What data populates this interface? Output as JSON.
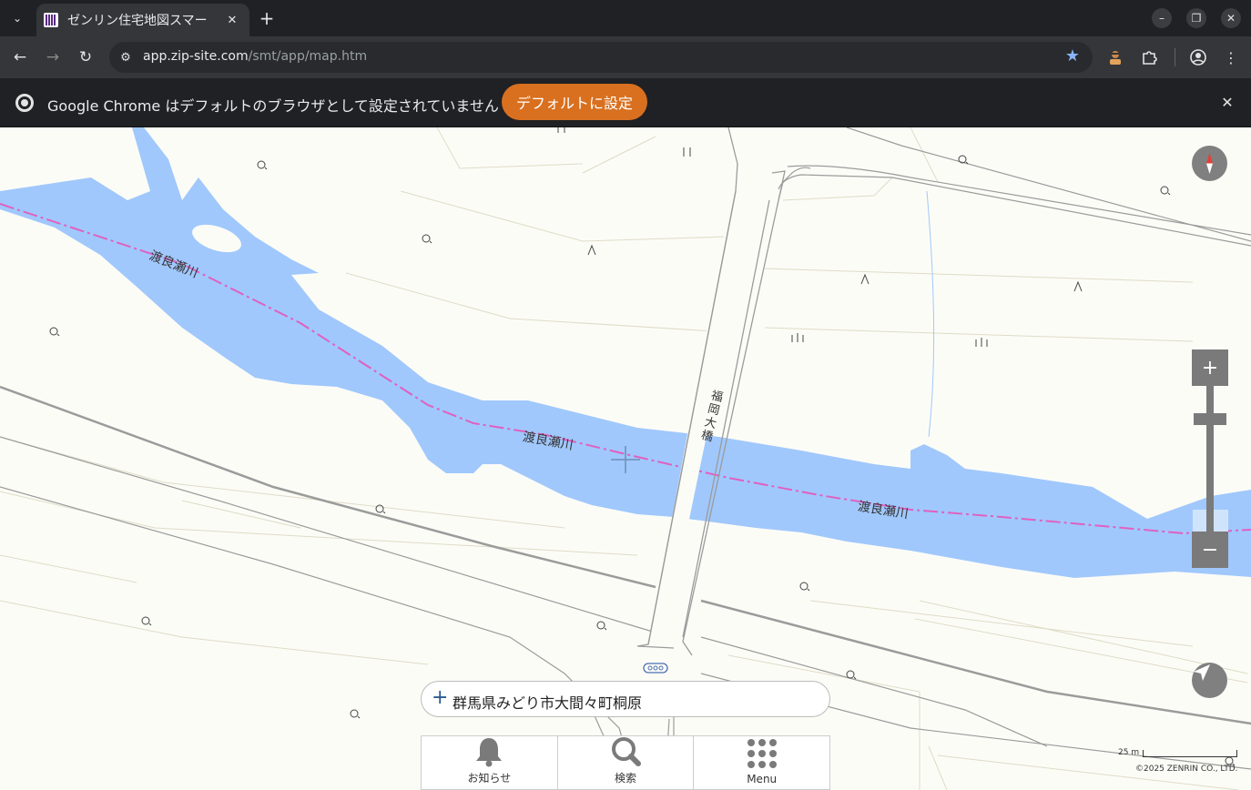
{
  "browser": {
    "tab_title": "ゼンリン住宅地図スマー",
    "url_host": "app.zip-site.com",
    "url_path": "/smt/app/map.htm",
    "infobar_text": "Google Chrome はデフォルトのブラウザとして設定されていません",
    "default_button_label": "デフォルトに設定",
    "icons": {
      "tab_search": "chevron-down-icon",
      "tab_close": "close-icon",
      "new_tab": "plus-icon",
      "back": "back-arrow-icon",
      "forward": "forward-arrow-icon",
      "reload": "reload-icon",
      "site_info": "tune-icon",
      "bookmark": "star-icon",
      "extension_agent": "incognito-agent-icon",
      "extensions": "puzzle-icon",
      "profile": "profile-icon",
      "menu": "kebab-menu-icon"
    }
  },
  "map": {
    "river_labels": [
      "渡良瀬川",
      "渡良瀬川",
      "渡良瀬川"
    ],
    "bridge_label": "福岡大橋",
    "address": "群馬県みどり市大間々町桐原",
    "zoom_in_label": "+",
    "zoom_out_label": "−",
    "scale_label": "25 m",
    "copyright": "©2025 ZENRIN CO., LTD.",
    "colors": {
      "water": "#a0c8fc",
      "boundary": "#e060c0",
      "controls": "#7a7a7a"
    }
  },
  "bottom_menu": {
    "items": [
      {
        "label": "お知らせ",
        "icon": "bell-icon"
      },
      {
        "label": "検索",
        "icon": "search-icon"
      },
      {
        "label": "Menu",
        "icon": "grid-menu-icon"
      }
    ]
  }
}
